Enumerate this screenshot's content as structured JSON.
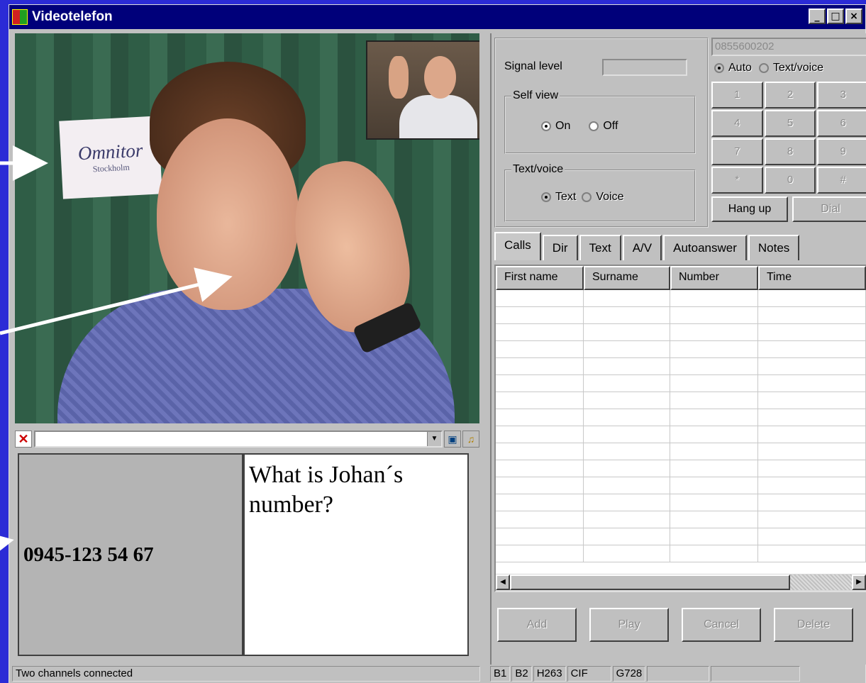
{
  "window": {
    "title": "Videotelefon"
  },
  "video": {
    "sign_title": "Omnitor",
    "sign_sub": "Stockholm"
  },
  "chat": {
    "remote_text": "0945-123 54 67",
    "local_text": "What is Johan´s number?"
  },
  "controls": {
    "signal_label": "Signal level",
    "selfview_title": "Self view",
    "selfview_on": "On",
    "selfview_off": "Off",
    "textvoice_title": "Text/voice",
    "text_option": "Text",
    "voice_option": "Voice"
  },
  "dialer": {
    "number": "0855600202",
    "mode_auto": "Auto",
    "mode_textvoice": "Text/voice",
    "keys": [
      "1",
      "2",
      "3",
      "4",
      "5",
      "6",
      "7",
      "8",
      "9",
      "*",
      "0",
      "#"
    ],
    "hangup": "Hang up",
    "dial": "Dial"
  },
  "tabs": [
    "Calls",
    "Dir",
    "Text",
    "A/V",
    "Autoanswer",
    "Notes"
  ],
  "table": {
    "columns": [
      "First name",
      "Surname",
      "Number",
      "Time"
    ]
  },
  "actions": [
    "Add",
    "Play",
    "Cancel",
    "Delete"
  ],
  "status": {
    "message": "Two channels connected",
    "b1": "B1",
    "b2": "B2",
    "h263": "H263",
    "cif": "CIF",
    "g728": "G728"
  }
}
